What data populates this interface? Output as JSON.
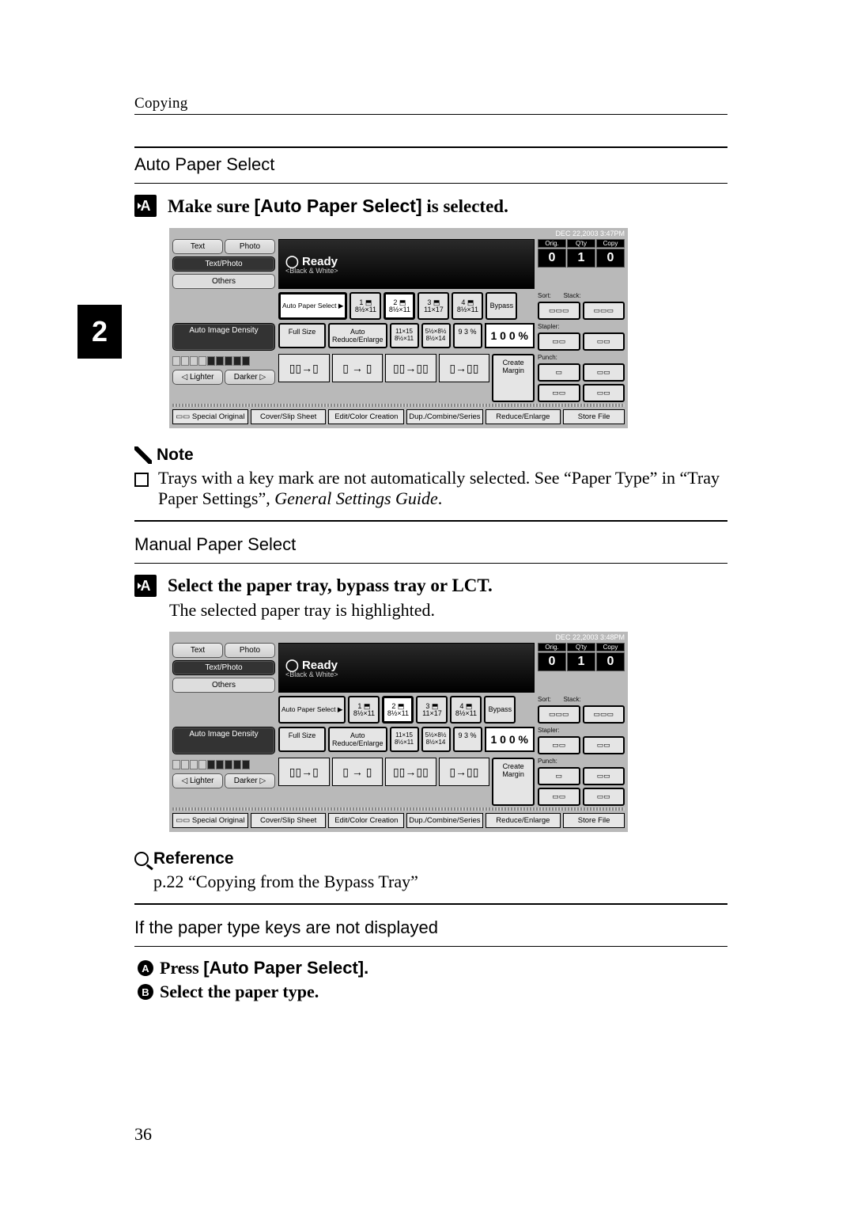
{
  "running_head": "Copying",
  "side_tab": "2",
  "page_number": "36",
  "sect1": {
    "heading": "Auto Paper Select",
    "step_prefix": "Make sure ",
    "step_bold": "[Auto Paper Select]",
    "step_suffix": " is selected.",
    "step_num": "A"
  },
  "note": {
    "title": "Note",
    "bullet": "❐",
    "text_pre": "Trays with a key mark are not automatically selected. See “Paper Type” in “Tray Paper Settings”, ",
    "text_italic": "General Settings Guide",
    "text_post": "."
  },
  "sect2": {
    "heading": "Manual Paper Select",
    "step_num": "A",
    "step_text": "Select the paper tray, bypass tray or LCT.",
    "followup": "The selected paper tray is highlighted."
  },
  "reference": {
    "title": "Reference",
    "body": "p.22 “Copying from the Bypass Tray”"
  },
  "sect3": {
    "heading": "If the paper type keys are not displayed",
    "s1_num": "A",
    "s1_pre": "Press ",
    "s1_bold": "[Auto Paper Select].",
    "s2_num": "B",
    "s2_text": "Select the paper type."
  },
  "screenshot": {
    "timestamp": "DEC  22,2003  3:47PM",
    "text": "Text",
    "photo": "Photo",
    "textphoto": "Text/Photo",
    "others": "Others",
    "ready": "Ready",
    "ready_sub": "<Black & White>",
    "auto_paper": "Auto Paper Select ▶",
    "trays": {
      "t1": {
        "top": "1 ⬒",
        "bot": "8½×11",
        "portrait": "D"
      },
      "t2": {
        "top": "2 ⬒",
        "bot": "8½×11",
        "portrait": "D"
      },
      "t3": {
        "top": "3 ⬒",
        "bot": "11×17",
        "portrait": "◻"
      },
      "t4": {
        "top": "4 ⬒",
        "bot": "8½×11",
        "portrait": "◻"
      },
      "bypass": "Bypass"
    },
    "counts": {
      "orig": "Orig.",
      "qty": "Q'ty",
      "copy": "Copy",
      "v1": "0",
      "v2": "1",
      "v3": "0"
    },
    "sort": "Sort:",
    "stack": "Stack:",
    "staplr": "Stapler:",
    "punch": "Punch:",
    "auto_density": "Auto Image Density",
    "full": "Full Size",
    "auto_re": "Auto Reduce/Enlarge",
    "ratio1": "11×15\n8½×11",
    "ratio2": "5½×8½\n8½×14",
    "ratio_cur": "9 3 %",
    "hundred": "1 0 0 %",
    "lighter": "◁ Lighter",
    "darker": "Darker ▷",
    "create": "Create Margin",
    "tabs": {
      "special": "Special Original",
      "cover": "Cover/Slip Sheet",
      "edit": "Edit/Color Creation",
      "dup": "Dup./Combine/Series",
      "reduce": "Reduce/Enlarge",
      "store": "Store File"
    }
  },
  "screenshot2_override": {
    "timestamp": "DEC  22,2003  3:48PM",
    "counts_v2": "1"
  }
}
